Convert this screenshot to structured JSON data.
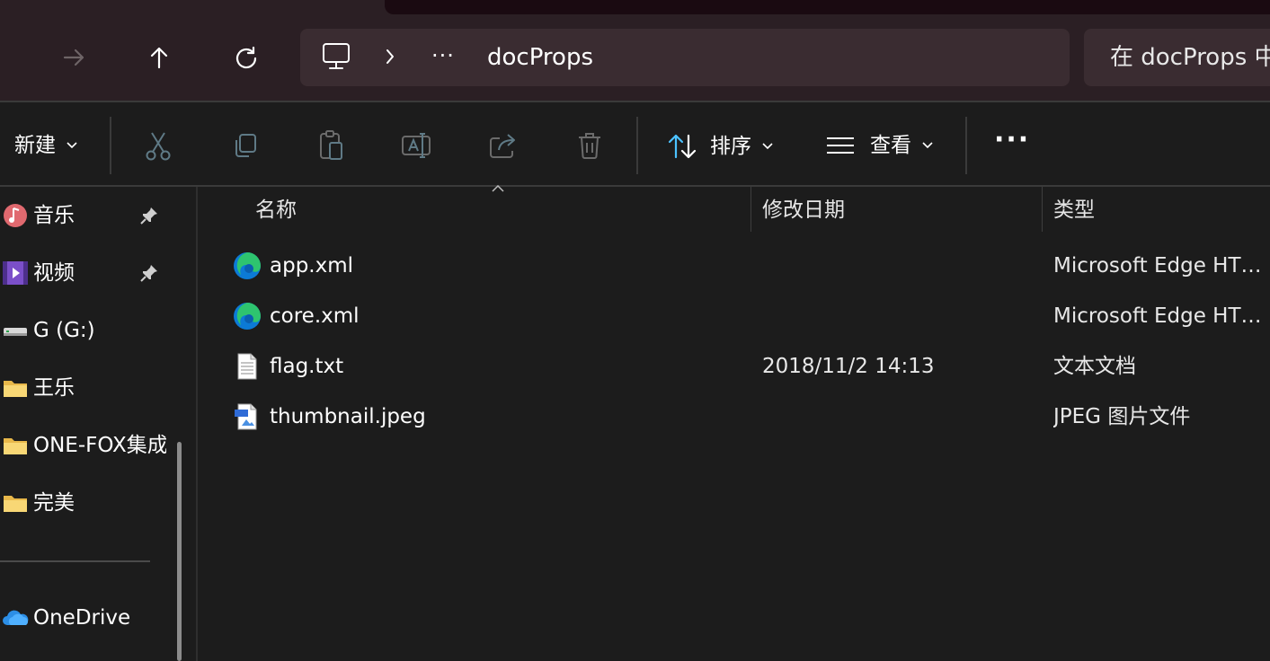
{
  "nav": {
    "forward_icon": "arrow-right-icon",
    "up_icon": "arrow-up-icon",
    "refresh_icon": "refresh-icon"
  },
  "address": {
    "root_icon": "this-pc-icon",
    "overflow": "···",
    "crumb": "docProps"
  },
  "search": {
    "placeholder": "在 docProps 中搜索"
  },
  "toolbar": {
    "new_label": "新建",
    "sort_label": "排序",
    "view_label": "查看",
    "more_label": "···"
  },
  "sidebar": {
    "items": [
      {
        "label": "音乐",
        "icon": "music-icon",
        "pinned": true
      },
      {
        "label": "视频",
        "icon": "video-icon",
        "pinned": true
      },
      {
        "label": "G (G:)",
        "icon": "drive-icon",
        "pinned": false
      },
      {
        "label": "王乐",
        "icon": "folder-icon",
        "pinned": false
      },
      {
        "label": "ONE-FOX集成",
        "icon": "folder-icon",
        "pinned": false
      },
      {
        "label": "完美",
        "icon": "folder-icon",
        "pinned": false
      },
      {
        "label": "OneDrive",
        "icon": "onedrive-icon",
        "pinned": false
      }
    ]
  },
  "columns": {
    "name": "名称",
    "modified": "修改日期",
    "type": "类型"
  },
  "files": [
    {
      "name": "app.xml",
      "modified": "",
      "type": "Microsoft Edge HTML Document",
      "icon": "edge-icon"
    },
    {
      "name": "core.xml",
      "modified": "",
      "type": "Microsoft Edge HTML Document",
      "icon": "edge-icon"
    },
    {
      "name": "flag.txt",
      "modified": "2018/11/2 14:13",
      "type": "文本文档",
      "icon": "text-file-icon"
    },
    {
      "name": "thumbnail.jpeg",
      "modified": "",
      "type": "JPEG 图片文件",
      "icon": "jpeg-file-icon"
    }
  ]
}
